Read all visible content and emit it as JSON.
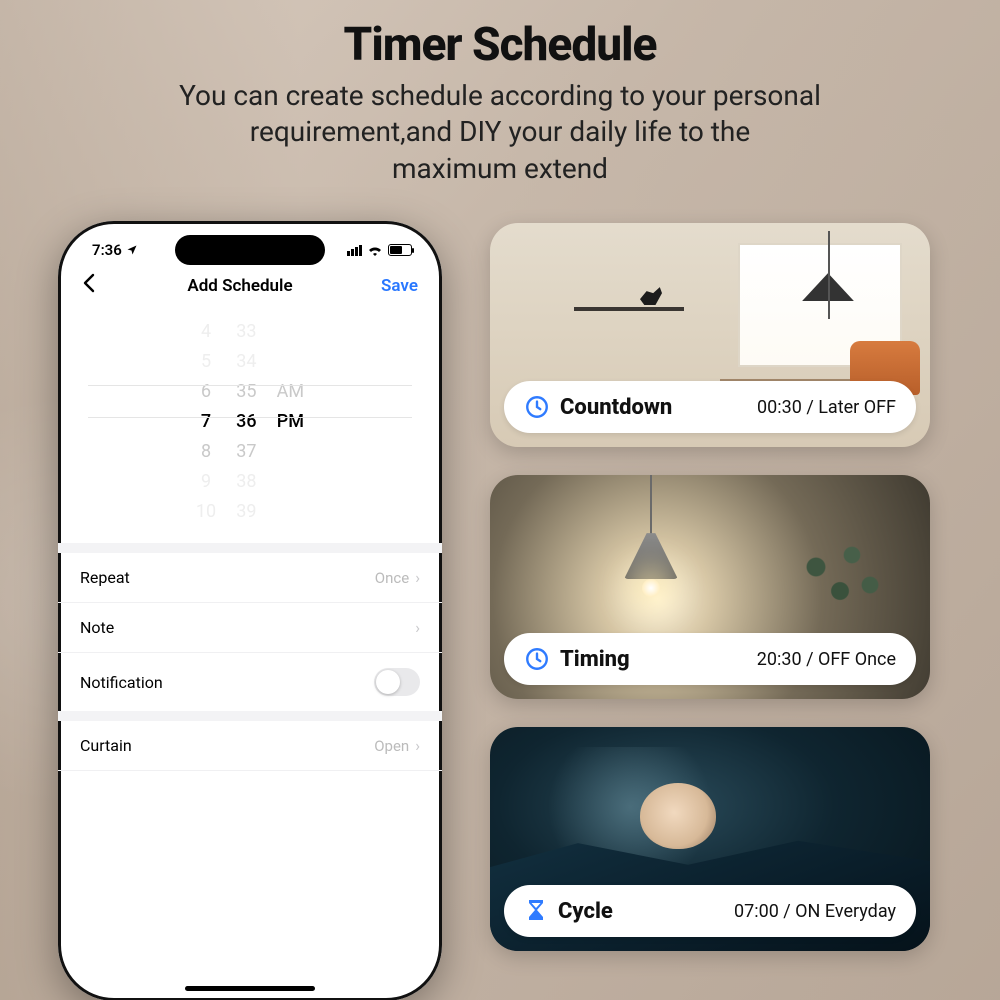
{
  "hero": {
    "title": "Timer Schedule",
    "line1": "You can create schedule according to your personal",
    "line2": "requirement,and DIY your daily life to the",
    "line3": "maximum extend"
  },
  "phone": {
    "status_time": "7:36",
    "nav_title": "Add Schedule",
    "save_label": "Save",
    "picker": {
      "hours": [
        "4",
        "5",
        "6",
        "7",
        "8",
        "9",
        "10"
      ],
      "minutes": [
        "33",
        "34",
        "35",
        "36",
        "37",
        "38",
        "39"
      ],
      "ampm": [
        "AM",
        "PM"
      ]
    },
    "rows": {
      "repeat_label": "Repeat",
      "repeat_value": "Once",
      "note_label": "Note",
      "notification_label": "Notification",
      "curtain_label": "Curtain",
      "curtain_value": "Open"
    }
  },
  "cards": [
    {
      "name": "Countdown",
      "detail": "00:30 / Later OFF",
      "icon": "clock"
    },
    {
      "name": "Timing",
      "detail": "20:30 / OFF Once",
      "icon": "clock"
    },
    {
      "name": "Cycle",
      "detail": "07:00 / ON Everyday",
      "icon": "hourglass"
    }
  ]
}
